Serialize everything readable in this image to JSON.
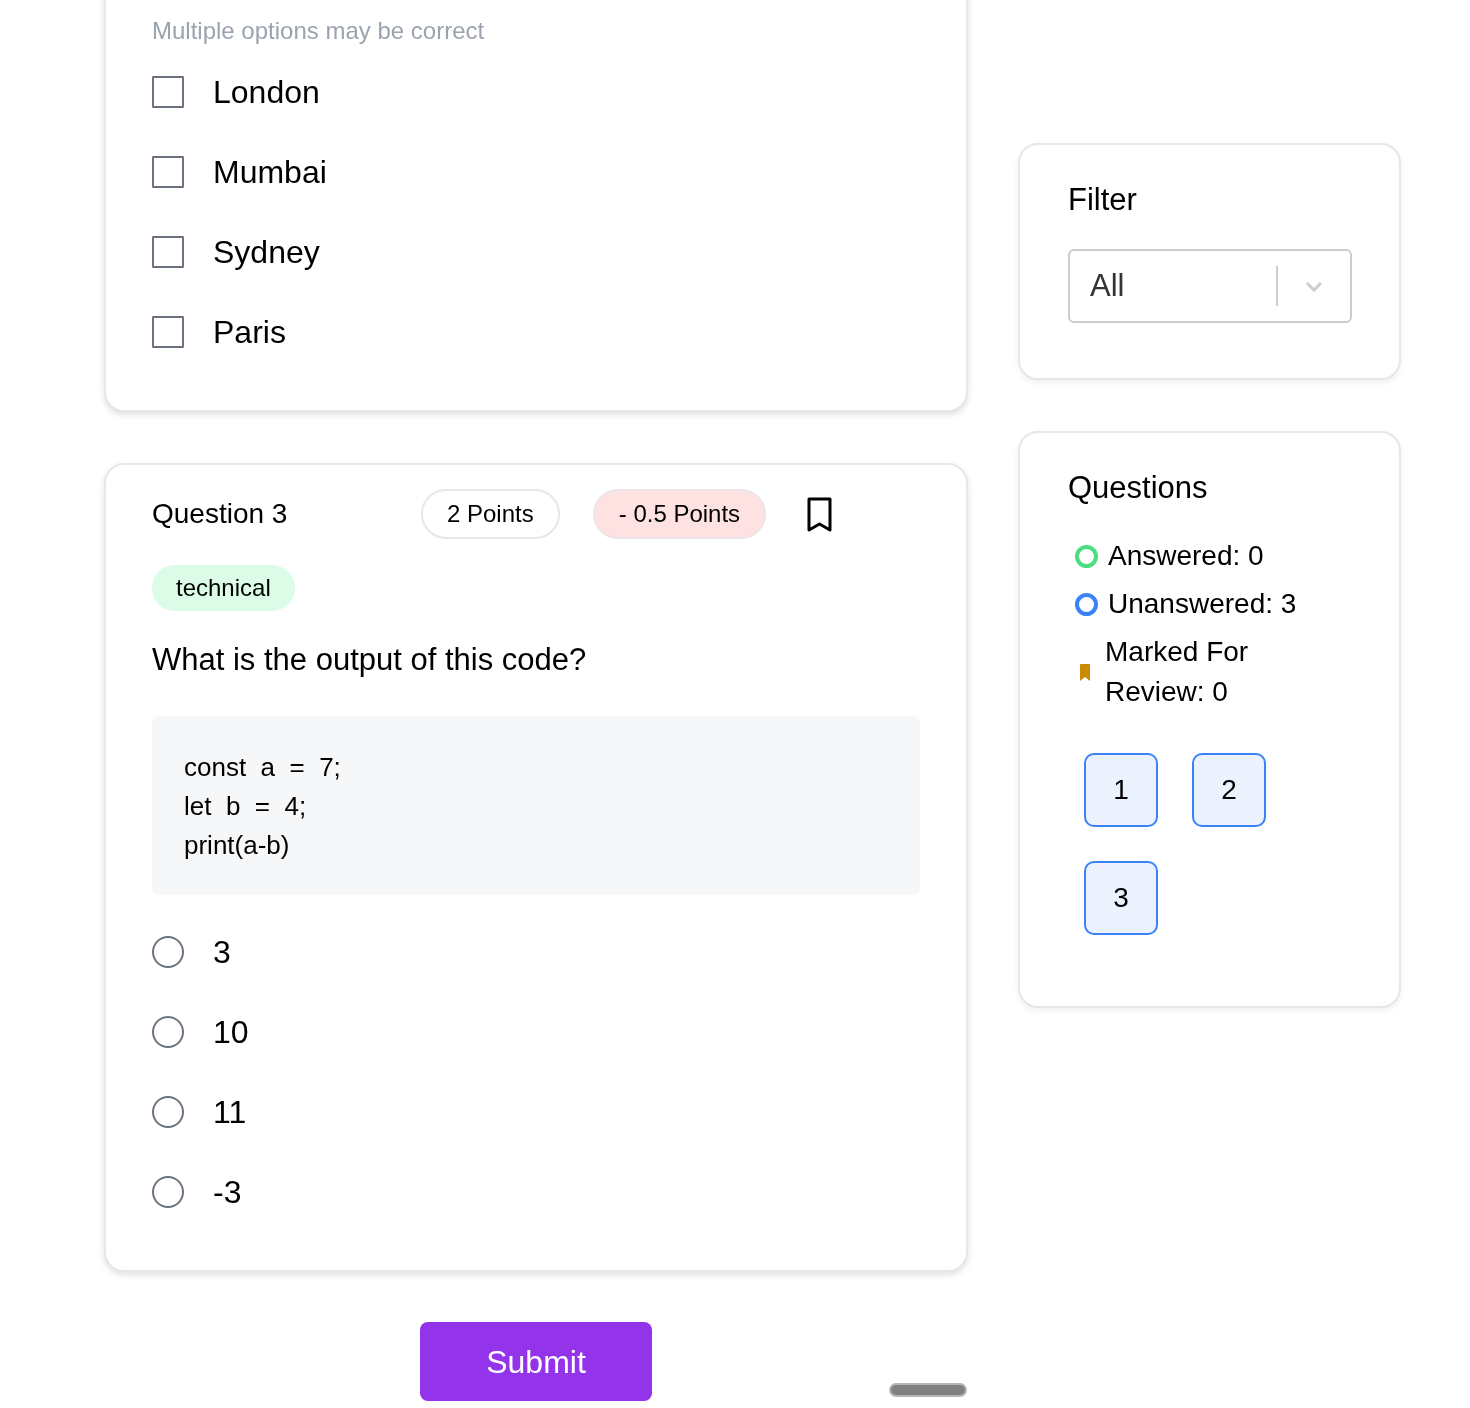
{
  "questions": [
    {
      "kind": "multiple",
      "hint": "Multiple options may be correct",
      "options": [
        {
          "label": "London",
          "checked": false
        },
        {
          "label": "Mumbai",
          "checked": false
        },
        {
          "label": "Sydney",
          "checked": false
        },
        {
          "label": "Paris",
          "checked": false
        }
      ]
    },
    {
      "kind": "single",
      "title": "Question 3",
      "points": "2 Points",
      "penalty": "- 0.5 Points",
      "bookmarked": false,
      "tag": "technical",
      "prompt": "What is the output of this code?",
      "code": [
        "const  a  =  7;",
        "let  b  =  4;",
        "print(a-b)"
      ],
      "options": [
        {
          "label": "3",
          "selected": false
        },
        {
          "label": "10",
          "selected": false
        },
        {
          "label": "11",
          "selected": false
        },
        {
          "label": "-3",
          "selected": false
        }
      ]
    }
  ],
  "submit_button": "Submit",
  "filter": {
    "title": "Filter",
    "value": "All"
  },
  "navigator": {
    "title": "Questions",
    "legend": [
      {
        "kind": "ring",
        "text": "Answered: 0",
        "color": "#4ade80"
      },
      {
        "kind": "ring",
        "text": "Unanswered: 3",
        "color": "#3b82f6"
      },
      {
        "kind": "bookmark",
        "text": "Marked For Review: 0",
        "color": "#ca8a04"
      }
    ],
    "buttons": [
      {
        "label": "1",
        "answered": false
      },
      {
        "label": "2",
        "answered": false
      },
      {
        "label": "3",
        "answered": false
      }
    ]
  }
}
